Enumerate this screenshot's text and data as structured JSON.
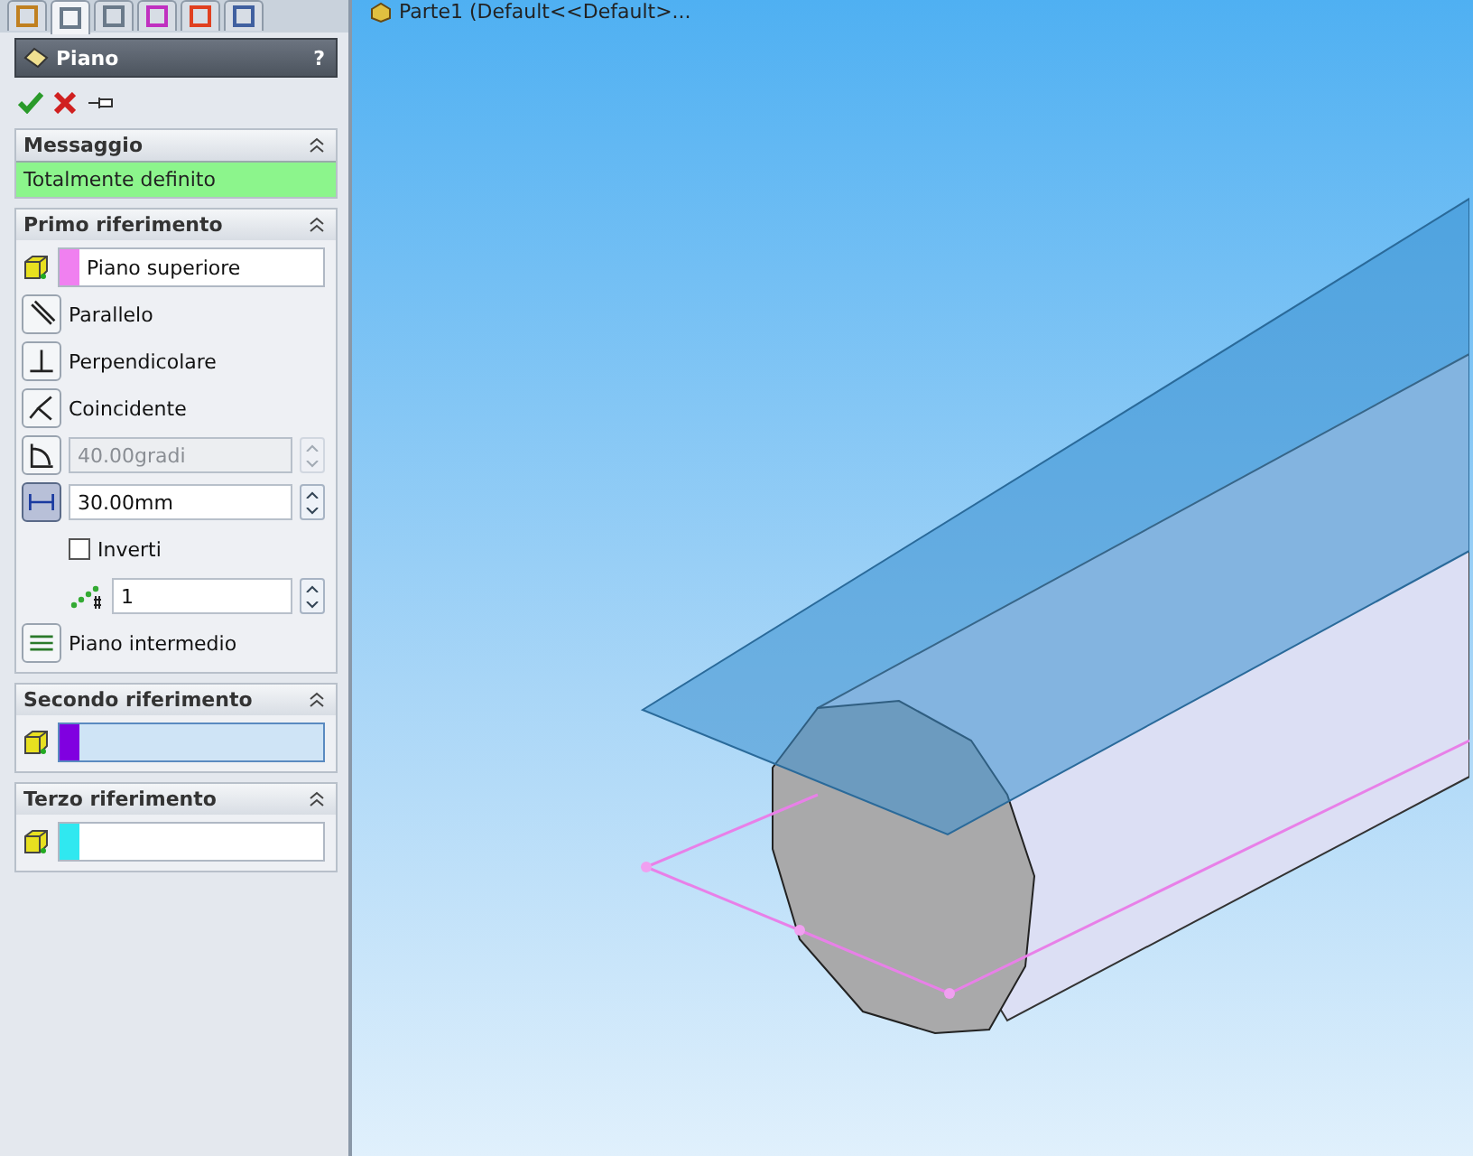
{
  "tabs": [
    {
      "selected": false
    },
    {
      "selected": true
    },
    {
      "selected": false
    },
    {
      "selected": false
    },
    {
      "selected": false
    },
    {
      "selected": false
    }
  ],
  "panel": {
    "title": "Piano",
    "help": "?"
  },
  "message_section": {
    "title": "Messaggio",
    "message": "Totalmente definito"
  },
  "first_reference": {
    "title": "Primo riferimento",
    "reference": {
      "value": "Piano superiore",
      "color": "#f080f0",
      "active": false
    },
    "options": [
      {
        "kind": "option",
        "label": "Parallelo",
        "selected": false
      },
      {
        "kind": "option",
        "label": "Perpendicolare",
        "selected": false
      },
      {
        "kind": "option",
        "label": "Coincidente",
        "selected": false
      },
      {
        "kind": "angle",
        "value": "40.00gradi",
        "selected": false,
        "disabled": true
      },
      {
        "kind": "distance",
        "value": "30.00mm",
        "selected": true,
        "disabled": false
      },
      {
        "kind": "checkbox",
        "label": "Inverti",
        "checked": false
      },
      {
        "kind": "count",
        "value": "1"
      },
      {
        "kind": "option",
        "label": "Piano intermedio",
        "selected": false
      }
    ]
  },
  "second_reference": {
    "title": "Secondo riferimento",
    "reference": {
      "color": "#8000e0",
      "active": true
    }
  },
  "third_reference": {
    "title": "Terzo riferimento",
    "reference": {
      "color": "#30e8f0",
      "active": false
    }
  },
  "viewport": {
    "tree_label": "Parte1 (Default<<Default>..."
  }
}
